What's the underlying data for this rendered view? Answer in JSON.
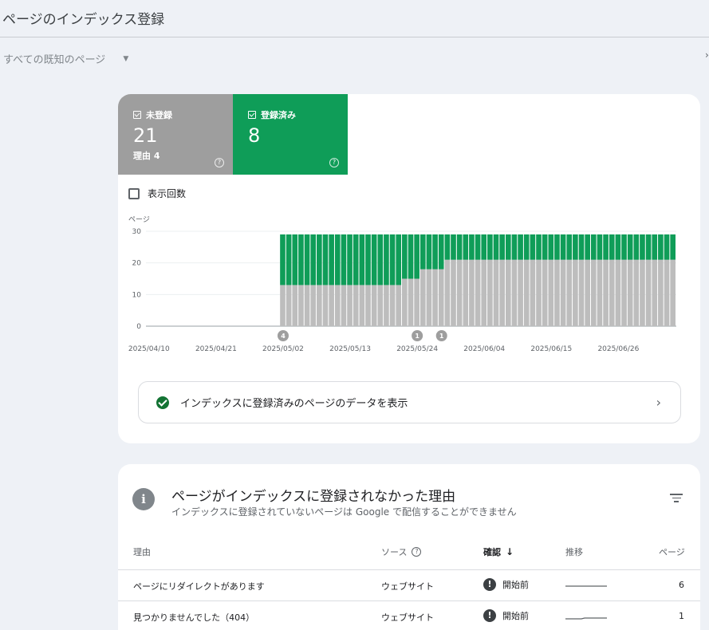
{
  "header": {
    "title": "ページのインデックス登録"
  },
  "filter": {
    "label": "すべての既知のページ"
  },
  "summary": {
    "not_indexed": {
      "label": "未登録",
      "count": "21",
      "reasons": "理由 4",
      "help": "?"
    },
    "indexed": {
      "label": "登録済み",
      "count": "8",
      "help": "?"
    }
  },
  "impressions_checkbox": {
    "label": "表示回数",
    "checked": false
  },
  "chart_data": {
    "type": "bar",
    "ylabel": "ページ",
    "ylim": [
      0,
      30
    ],
    "yticks": [
      0,
      10,
      20,
      30
    ],
    "xtick_labels": [
      "2025/04/10",
      "2025/04/21",
      "2025/05/02",
      "2025/05/13",
      "2025/05/24",
      "2025/06/04",
      "2025/06/15",
      "2025/06/26"
    ],
    "start_date": "2025-04-10",
    "days": 87,
    "data_start_day": 22,
    "series": [
      {
        "name": "未登録",
        "color": "#bdbdbd",
        "segments": [
          {
            "from_day": 22,
            "to_day": 41,
            "value": 13
          },
          {
            "from_day": 42,
            "to_day": 44,
            "value": 15
          },
          {
            "from_day": 45,
            "to_day": 48,
            "value": 18
          },
          {
            "from_day": 49,
            "to_day": 86,
            "value": 21
          }
        ]
      },
      {
        "name": "登録済み",
        "color": "#0f9d58",
        "segments": [
          {
            "from_day": 22,
            "to_day": 41,
            "value": 16
          },
          {
            "from_day": 42,
            "to_day": 44,
            "value": 14
          },
          {
            "from_day": 45,
            "to_day": 48,
            "value": 11
          },
          {
            "from_day": 49,
            "to_day": 86,
            "value": 8
          }
        ]
      }
    ],
    "annotations": [
      {
        "day": 22,
        "label": "4"
      },
      {
        "day": 44,
        "label": "1"
      },
      {
        "day": 48,
        "label": "1"
      }
    ]
  },
  "view_indexed_link": {
    "label": "インデックスに登録済みのページのデータを表示",
    "chevron": "›"
  },
  "reasons_card": {
    "title": "ページがインデックスに登録されなかった理由",
    "subtitle": "インデックスに登録されていないページは Google で配信することができません",
    "info_glyph": "i",
    "columns": {
      "reason": "理由",
      "source": "ソース",
      "validation": "確認",
      "trend": "推移",
      "pages": "ページ"
    },
    "rows": [
      {
        "reason": "ページにリダイレクトがあります",
        "source": "ウェブサイト",
        "validation": "開始前",
        "pages": "6"
      },
      {
        "reason": "見つかりませんでした（404）",
        "source": "ウェブサイト",
        "validation": "開始前",
        "pages": "1"
      }
    ]
  }
}
